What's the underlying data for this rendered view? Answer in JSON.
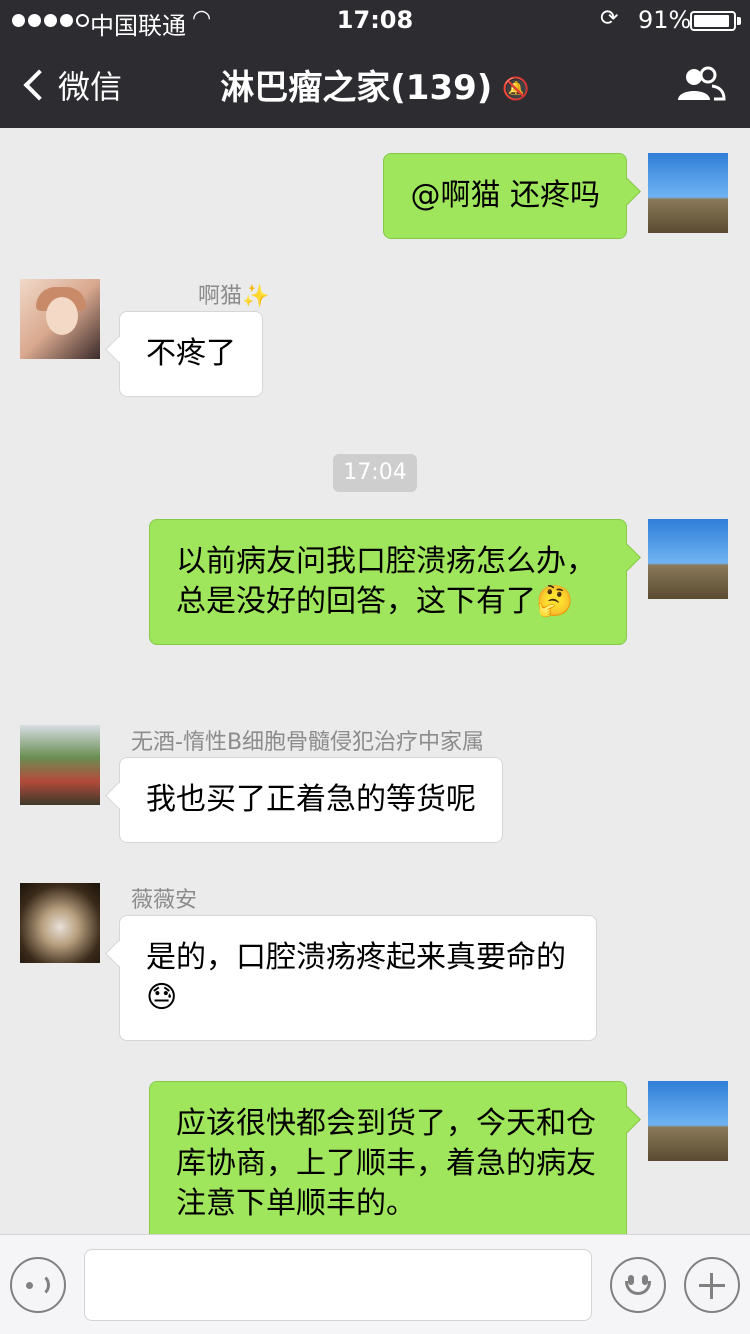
{
  "status_bar": {
    "carrier": "中国联通",
    "time": "17:08",
    "battery_percent": "91%",
    "battery_level": 0.91,
    "signal_bars": 4
  },
  "nav": {
    "back_label": "微信",
    "title": "淋巴瘤之家(139)",
    "mute_icon": "mute-bell-icon",
    "right_icon": "group-members-icon"
  },
  "messages": [
    {
      "direction": "out",
      "text": "@啊猫 还疼吗"
    },
    {
      "direction": "in",
      "sender": "啊猫✨",
      "text": "不疼了"
    },
    {
      "direction": "out",
      "text": "以前病友问我口腔溃疡怎么办，总是没好的回答，这下有了🤔"
    },
    {
      "direction": "in",
      "sender": "无酒-惰性B细胞骨髓侵犯治疗中家属",
      "text": "我也买了正着急的等货呢"
    },
    {
      "direction": "in",
      "sender": "薇薇安",
      "text": "是的，口腔溃疡疼起来真要命的😓"
    },
    {
      "direction": "out",
      "text": "应该很快都会到货了，今天和仓库协商，上了顺丰，着急的病友注意下单顺丰的。"
    }
  ],
  "timestamp": "17:04",
  "input_bar": {
    "voice_icon": "voice-icon",
    "emoji_icon": "emoji-icon",
    "plus_icon": "plus-icon",
    "text_value": ""
  },
  "colors": {
    "nav_bg": "#2c2c31",
    "chat_bg": "#ebebeb",
    "outgoing_bubble": "#9fe65c",
    "incoming_bubble": "#ffffff"
  }
}
